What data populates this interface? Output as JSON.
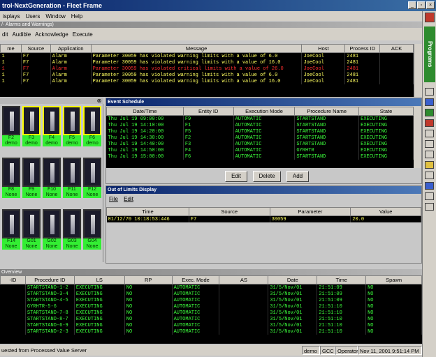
{
  "window": {
    "title": "trol-NextGeneration - Fleet Frame",
    "min": "_",
    "max": "▫",
    "close": "×"
  },
  "menu": [
    "isplays",
    "Users",
    "Window",
    "Help"
  ],
  "alarms": {
    "title": "/- Alarms and Warnings)",
    "toolbar": [
      "dit",
      "Audible",
      "Acknowledge",
      "Execute"
    ],
    "columns": [
      "me",
      "Source",
      "Application",
      "Message",
      "Host",
      "Process ID",
      "ACK"
    ],
    "rows": [
      {
        "c0": "1",
        "source": "F7",
        "app": "Alarm",
        "msg": "Parameter 30059 has violated warning limits with a value of 6.0",
        "host": "JoeCool",
        "pid": "2481",
        "ack": "",
        "cls": "y"
      },
      {
        "c0": "1",
        "source": "F7",
        "app": "Alarm",
        "msg": "Parameter 30059 has violated warning limits with a value of 16.0",
        "host": "JoeCool",
        "pid": "2481",
        "ack": "",
        "cls": "y"
      },
      {
        "c0": "1",
        "source": "F7",
        "app": "Alarm",
        "msg": "Parameter 30059 has violated critical limits with a value of 26.0",
        "host": "JoeCool",
        "pid": "2481",
        "ack": "",
        "cls": "r"
      },
      {
        "c0": "1",
        "source": "F7",
        "app": "Alarm",
        "msg": "Parameter 30059 has violated warning limits with a value of 6.0",
        "host": "JoeCool",
        "pid": "2481",
        "ack": "",
        "cls": "y"
      },
      {
        "c0": "1",
        "source": "F7",
        "app": "Alarm",
        "msg": "Parameter 30059 has violated warning limits with a value of 16.0",
        "host": "JoeCool",
        "pid": "2481",
        "ack": "",
        "cls": "y"
      }
    ]
  },
  "icons": [
    {
      "label1": "F2",
      "label2": "demo",
      "sel": false
    },
    {
      "label1": "F3",
      "label2": "demo",
      "sel": true
    },
    {
      "label1": "F4",
      "label2": "demo",
      "sel": true
    },
    {
      "label1": "F5",
      "label2": "demo",
      "sel": true
    },
    {
      "label1": "F6",
      "label2": "demo",
      "sel": true
    },
    {
      "label1": "F8",
      "label2": "None",
      "sel": false
    },
    {
      "label1": "F9",
      "label2": "None",
      "sel": false
    },
    {
      "label1": "F10",
      "label2": "None",
      "sel": false
    },
    {
      "label1": "F11",
      "label2": "None",
      "sel": false
    },
    {
      "label1": "F12",
      "label2": "None",
      "sel": false
    },
    {
      "label1": "F14",
      "label2": "None",
      "sel": false
    },
    {
      "label1": "G01",
      "label2": "None",
      "sel": false
    },
    {
      "label1": "G02",
      "label2": "None",
      "sel": false
    },
    {
      "label1": "G03",
      "label2": "None",
      "sel": false
    },
    {
      "label1": "G04",
      "label2": "None",
      "sel": false
    }
  ],
  "event_schedule": {
    "title": "Event Schedule",
    "columns": [
      "Date/Time",
      "Entity ID",
      "Execution Mode",
      "Procedure Name",
      "State"
    ],
    "rows": [
      [
        "Thu Jul 19 09:00:00",
        "F9",
        "AUTOMATIC",
        "STARTSTAND",
        "EXECUTING"
      ],
      [
        "Thu Jul 19 14:10:00",
        "F1",
        "AUTOMATIC",
        "STARTSTAND",
        "EXECUTING"
      ],
      [
        "Thu Jul 19 14:20:00",
        "F5",
        "AUTOMATIC",
        "STARTSTAND",
        "EXECUTING"
      ],
      [
        "Thu Jul 19 14:30:00",
        "F2",
        "AUTOMATIC",
        "STARTSTAND",
        "EXECUTING"
      ],
      [
        "Thu Jul 19 14:40:00",
        "F3",
        "AUTOMATIC",
        "STARTSTAND",
        "EXECUTING"
      ],
      [
        "Thu Jul 19 14:50:00",
        "F4",
        "AUTOMATIC",
        "GYRHTR",
        "EXECUTING"
      ],
      [
        "Thu Jul 19 15:00:00",
        "F6",
        "AUTOMATIC",
        "STARTSTAND",
        "EXECUTING"
      ]
    ],
    "buttons": [
      "Edit",
      "Delete",
      "Add"
    ]
  },
  "out_of_limits": {
    "title": "Out of Limits Display",
    "menu": [
      "File",
      "Edit"
    ],
    "columns": [
      "Time",
      "Source",
      "Parameter",
      "Value"
    ],
    "rows": [
      [
        "01/12/70 10:18:53:446",
        "F7",
        "30059",
        "20.0"
      ]
    ]
  },
  "overview": {
    "title": "Overview",
    "columns": [
      "-ID",
      "Procedure ID",
      "LS",
      "RP",
      "Exec. Mode",
      "AS",
      "Date",
      "Time",
      "Spawn"
    ],
    "rows": [
      [
        "",
        "STARTSTAND-1-2",
        "EXECUTING",
        "NO",
        "AUTOMATIC",
        "",
        "31/5/Nov/01",
        "21:51:09",
        "NO"
      ],
      [
        "",
        "STARTSTAND-3-4",
        "EXECUTING",
        "NO",
        "AUTOMATIC",
        "",
        "31/5/Nov/01",
        "21:51:09",
        "NO"
      ],
      [
        "",
        "STARTSTAND-4-5",
        "EXECUTING",
        "NO",
        "AUTOMATIC",
        "",
        "31/5/Nov/01",
        "21:51:09",
        "NO"
      ],
      [
        "",
        "GYRHTR-5-6",
        "EXECUTING",
        "NO",
        "AUTOMATIC",
        "",
        "31/5/Nov/01",
        "21:51:10",
        "NO"
      ],
      [
        "",
        "STARTSTAND-7-8",
        "EXECUTING",
        "NO",
        "AUTOMATIC",
        "",
        "31/5/Nov/01",
        "21:51:10",
        "NO"
      ],
      [
        "",
        "STARTSTAND-8-7",
        "EXECUTING",
        "NO",
        "AUTOMATIC",
        "",
        "31/5/Nov/01",
        "21:51:10",
        "NO"
      ],
      [
        "",
        "STARTSTAND-6-9",
        "EXECUTING",
        "NO",
        "AUTOMATIC",
        "",
        "31/5/Nov/01",
        "21:51:10",
        "NO"
      ],
      [
        "",
        "STARTSTAND-2-3",
        "EXECUTING",
        "NO",
        "AUTOMATIC",
        "",
        "31/5/Nov/01",
        "21:51:10",
        "NO"
      ]
    ]
  },
  "status": {
    "message": "uested from Processed Value Server",
    "host": "demo",
    "group": "GCC",
    "role": "Operator",
    "datetime": "Nov 11, 2001 9:51:14 PM"
  },
  "sidebar": {
    "label": "Programs"
  },
  "colors": {
    "title_active": "#0a246a",
    "green": "#33ee33",
    "yellow_text": "#ffff60",
    "red_text": "#ff3030",
    "green_text": "#3cff3c"
  }
}
